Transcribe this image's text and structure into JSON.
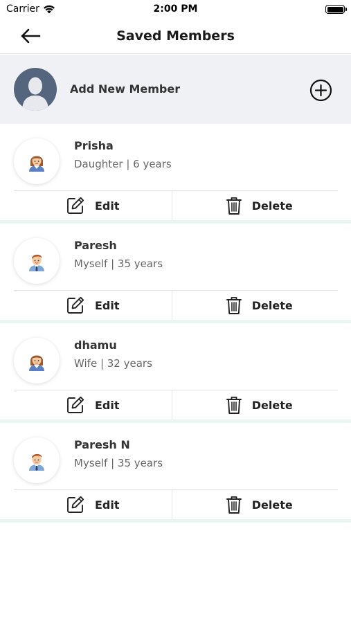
{
  "status_bar": {
    "carrier": "Carrier",
    "time": "2:00 PM"
  },
  "header": {
    "title": "Saved Members"
  },
  "add_member": {
    "label": "Add New Member"
  },
  "members": [
    {
      "name": "Prisha",
      "detail": "Daughter | 6 years",
      "avatar": "girl-avatar-icon"
    },
    {
      "name": "Paresh",
      "detail": "Myself | 35 years",
      "avatar": "boy-avatar-icon"
    },
    {
      "name": "dhamu",
      "detail": "Wife | 32 years",
      "avatar": "girl-avatar-icon"
    },
    {
      "name": "Paresh N",
      "detail": "Myself | 35 years",
      "avatar": "boy-avatar-icon"
    }
  ],
  "actions": {
    "edit_label": "Edit",
    "delete_label": "Delete"
  },
  "colors": {
    "add_row_bg": "#f0f1f5",
    "avatar_placeholder": "#56657e",
    "card_divider": "#eaf5f3"
  }
}
